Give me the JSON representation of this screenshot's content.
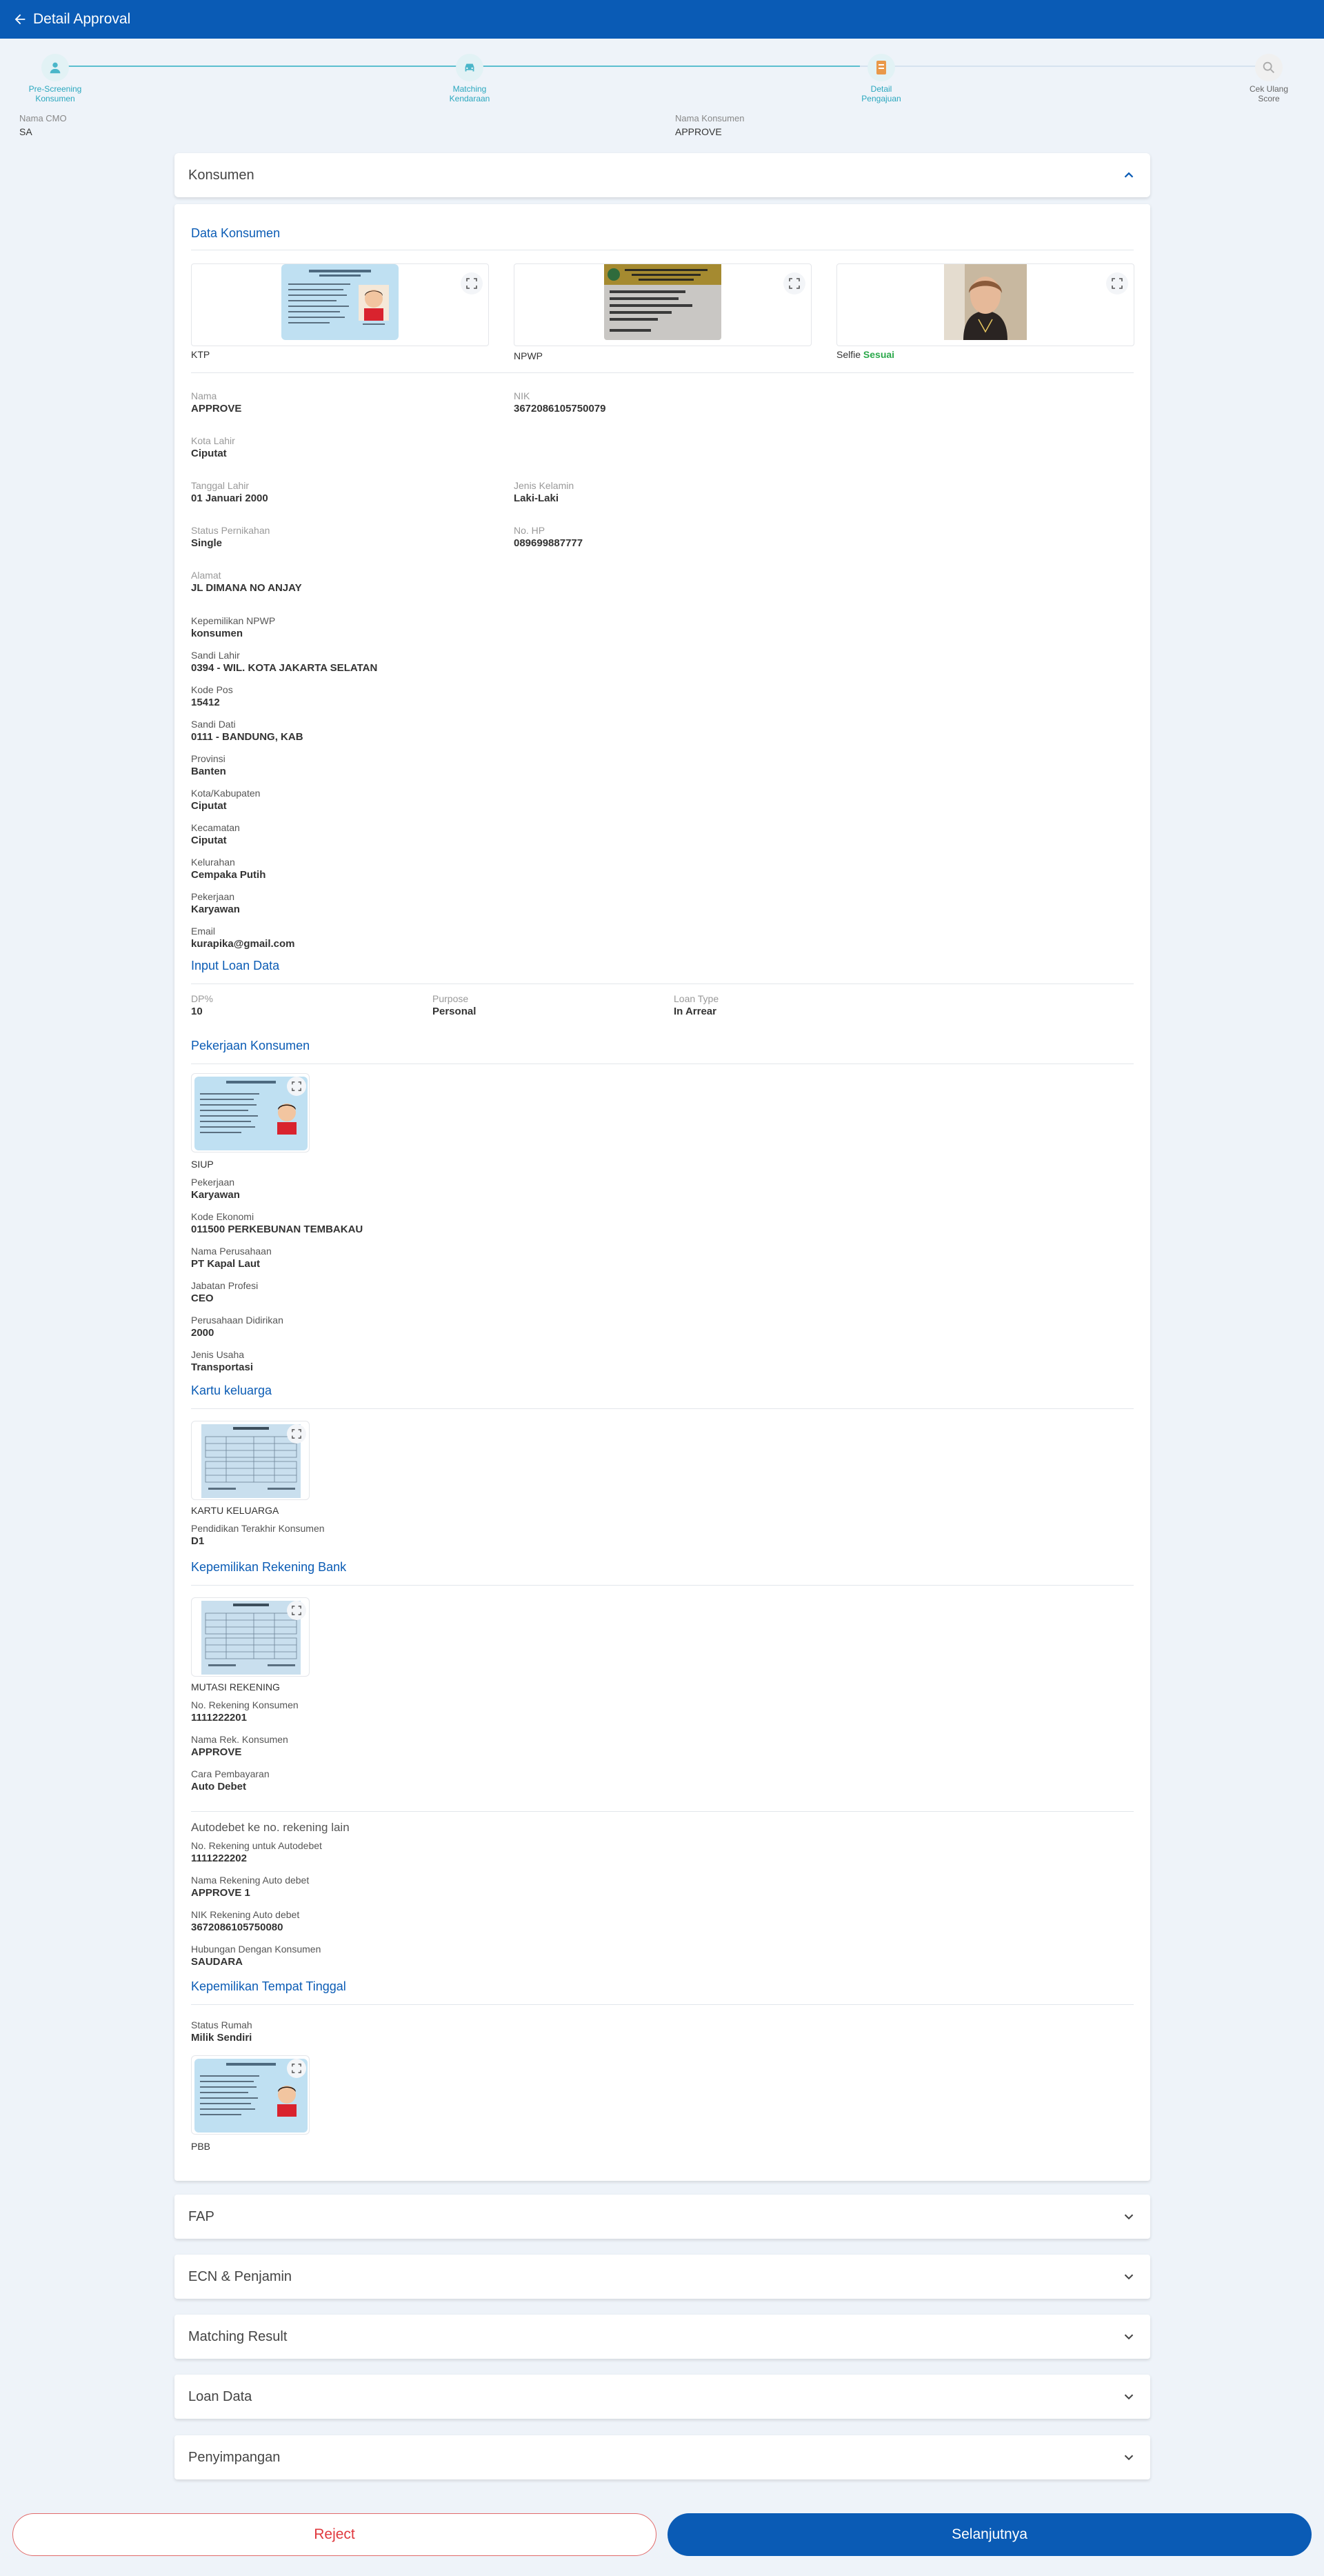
{
  "header": {
    "title": "Detail Approval"
  },
  "stepper": {
    "progress": 0.66,
    "steps": [
      {
        "line1": "Pre-Screening",
        "line2": "Konsumen"
      },
      {
        "line1": "Matching",
        "line2": "Kendaraan"
      },
      {
        "line1": "Detail",
        "line2": "Pengajuan"
      },
      {
        "line1": "Cek Ulang",
        "line2": "Score"
      }
    ]
  },
  "summary": {
    "cmo_label": "Nama CMO",
    "cmo_value": "SA",
    "konsumen_label": "Nama Konsumen",
    "konsumen_value": "APPROVE"
  },
  "konsumen_card": {
    "title": "Konsumen"
  },
  "data_konsumen": {
    "title": "Data Konsumen",
    "docs": {
      "ktp": "KTP",
      "npwp": "NPWP",
      "selfie": "Selfie",
      "selfie_status": "Sesuai"
    },
    "fields": {
      "nama_k": "Nama",
      "nama_v": "APPROVE",
      "nik_k": "NIK",
      "nik_v": "3672086105750079",
      "kota_lahir_k": "Kota Lahir",
      "kota_lahir_v": "Ciputat",
      "tgl_lahir_k": "Tanggal Lahir",
      "tgl_lahir_v": "01 Januari 2000",
      "jk_k": "Jenis Kelamin",
      "jk_v": "Laki-Laki",
      "status_k": "Status Pernikahan",
      "status_v": "Single",
      "hp_k": "No. HP",
      "hp_v": "089699887777",
      "alamat_k": "Alamat",
      "alamat_v": "JL DIMANA NO ANJAY",
      "npwp_k": "Kepemilikan NPWP",
      "npwp_v": "konsumen",
      "sandi_lahir_k": "Sandi Lahir",
      "sandi_lahir_v": "0394 - WIL. KOTA JAKARTA SELATAN",
      "kodepos_k": "Kode Pos",
      "kodepos_v": "15412",
      "sandi_dati_k": "Sandi Dati",
      "sandi_dati_v": "0111 - BANDUNG, KAB",
      "provinsi_k": "Provinsi",
      "provinsi_v": "Banten",
      "kota_k": "Kota/Kabupaten",
      "kota_v": "Ciputat",
      "kecamatan_k": "Kecamatan",
      "kecamatan_v": "Ciputat",
      "kelurahan_k": "Kelurahan",
      "kelurahan_v": "Cempaka Putih",
      "pekerjaan_k": "Pekerjaan",
      "pekerjaan_v": "Karyawan",
      "email_k": "Email",
      "email_v": "kurapika@gmail.com"
    }
  },
  "loan": {
    "title": "Input Loan Data",
    "dp_k": "DP%",
    "dp_v": "10",
    "purpose_k": "Purpose",
    "purpose_v": "Personal",
    "type_k": "Loan Type",
    "type_v": "In Arrear"
  },
  "pekerjaan": {
    "title": "Pekerjaan Konsumen",
    "doc": "SIUP",
    "pekerjaan_k": "Pekerjaan",
    "pekerjaan_v": "Karyawan",
    "kode_k": "Kode Ekonomi",
    "kode_v": "011500 PERKEBUNAN TEMBAKAU",
    "perusahaan_k": "Nama Perusahaan",
    "perusahaan_v": "PT Kapal Laut",
    "jabatan_k": "Jabatan Profesi",
    "jabatan_v": "CEO",
    "didirikan_k": "Perusahaan Didirikan",
    "didirikan_v": "2000",
    "usaha_k": "Jenis Usaha",
    "usaha_v": "Transportasi"
  },
  "kk": {
    "title": "Kartu keluarga",
    "doc": "KARTU KELUARGA",
    "pendidikan_k": "Pendidikan Terakhir Konsumen",
    "pendidikan_v": "D1"
  },
  "bank": {
    "title": "Kepemilikan Rekening Bank",
    "doc": "MUTASI REKENING",
    "norek_k": "No. Rekening Konsumen",
    "norek_v": "1111222201",
    "nama_k": "Nama Rek. Konsumen",
    "nama_v": "APPROVE",
    "cara_k": "Cara Pembayaran",
    "cara_v": "Auto Debet",
    "autodebet_title": "Autodebet ke no. rekening lain",
    "ad_norek_k": "No. Rekening untuk Autodebet",
    "ad_norek_v": "1111222202",
    "ad_nama_k": "Nama Rekening Auto debet",
    "ad_nama_v": "APPROVE 1",
    "ad_nik_k": "NIK Rekening Auto debet",
    "ad_nik_v": "3672086105750080",
    "hub_k": "Hubungan Dengan Konsumen",
    "hub_v": "SAUDARA"
  },
  "rumah": {
    "title": "Kepemilikan Tempat Tinggal",
    "status_k": "Status Rumah",
    "status_v": "Milik Sendiri",
    "doc": "PBB"
  },
  "accordions": [
    "FAP",
    "ECN & Penjamin",
    "Matching Result",
    "Loan Data",
    "Penyimpangan"
  ],
  "actions": {
    "reject": "Reject",
    "next": "Selanjutnya"
  },
  "colors": {
    "primary": "#0a5bb5",
    "accent": "#2aa7be",
    "success": "#2aa84a",
    "danger": "#e0393e"
  }
}
